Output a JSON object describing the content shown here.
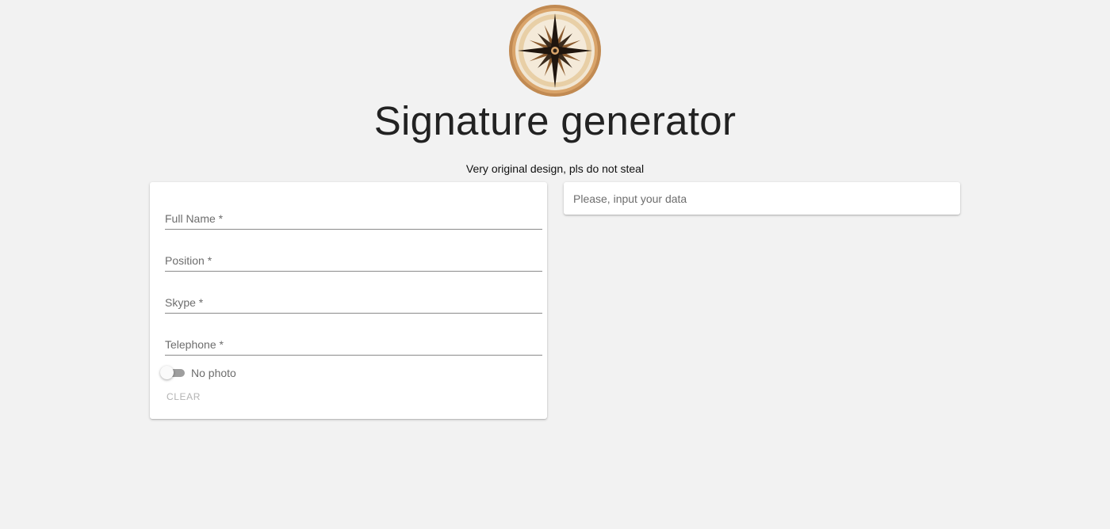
{
  "header": {
    "logo_icon": "compass-rose-icon",
    "title": "Signature generator",
    "subtitle": "Very original design, pls do not steal"
  },
  "form": {
    "fields": [
      {
        "label": "Full Name *",
        "value": ""
      },
      {
        "label": "Position *",
        "value": ""
      },
      {
        "label": "Skype *",
        "value": ""
      },
      {
        "label": "Telephone *",
        "value": ""
      }
    ],
    "photo_toggle": {
      "label": "No photo",
      "checked": false
    },
    "clear_label": "CLEAR"
  },
  "preview": {
    "placeholder": "Please, input your data"
  },
  "colors": {
    "background": "#f2f2f2",
    "card": "#ffffff",
    "logo_wood": "#c9935a",
    "logo_star": "#2b1e14"
  }
}
